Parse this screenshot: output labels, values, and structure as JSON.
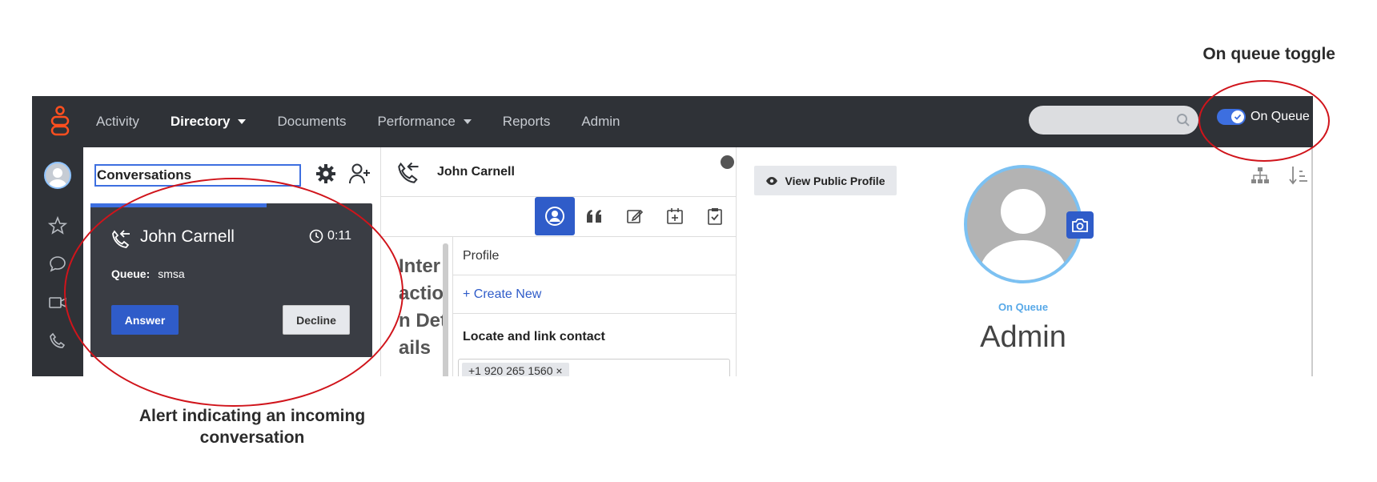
{
  "annotations": {
    "toggle_caption": "On queue toggle",
    "alert_caption": "Alert indicating an incoming conversation"
  },
  "topnav": {
    "items": [
      {
        "label": "Activity",
        "active": false,
        "dropdown": false
      },
      {
        "label": "Directory",
        "active": true,
        "dropdown": true
      },
      {
        "label": "Documents",
        "active": false,
        "dropdown": false
      },
      {
        "label": "Performance",
        "active": false,
        "dropdown": true
      },
      {
        "label": "Reports",
        "active": false,
        "dropdown": false
      },
      {
        "label": "Admin",
        "active": false,
        "dropdown": false
      }
    ],
    "search": {
      "placeholder": ""
    },
    "queue_toggle": {
      "label": "On Queue",
      "on": true
    }
  },
  "sidebar": {
    "icons": [
      "avatar",
      "star-icon",
      "chat-icon",
      "video-icon",
      "phone-icon"
    ]
  },
  "conversations": {
    "title": "Conversations",
    "alert": {
      "caller": "John Carnell",
      "timer": "0:11",
      "queue_label": "Queue:",
      "queue_value": "smsa",
      "answer_label": "Answer",
      "decline_label": "Decline"
    }
  },
  "interaction": {
    "caller": "John Carnell",
    "side_text": "Interaction Details",
    "rows": {
      "profile": "Profile",
      "create_new": "+ Create New",
      "locate": "Locate and link contact"
    },
    "chip": "+1 920 265 1560"
  },
  "profile": {
    "view_button": "View Public Profile",
    "status": "On Queue",
    "name": "Admin"
  },
  "colors": {
    "accent": "#2f5cc9",
    "nav_bg": "#2f3237",
    "annotation_red": "#d0141b",
    "status_blue": "#58a9e8"
  }
}
